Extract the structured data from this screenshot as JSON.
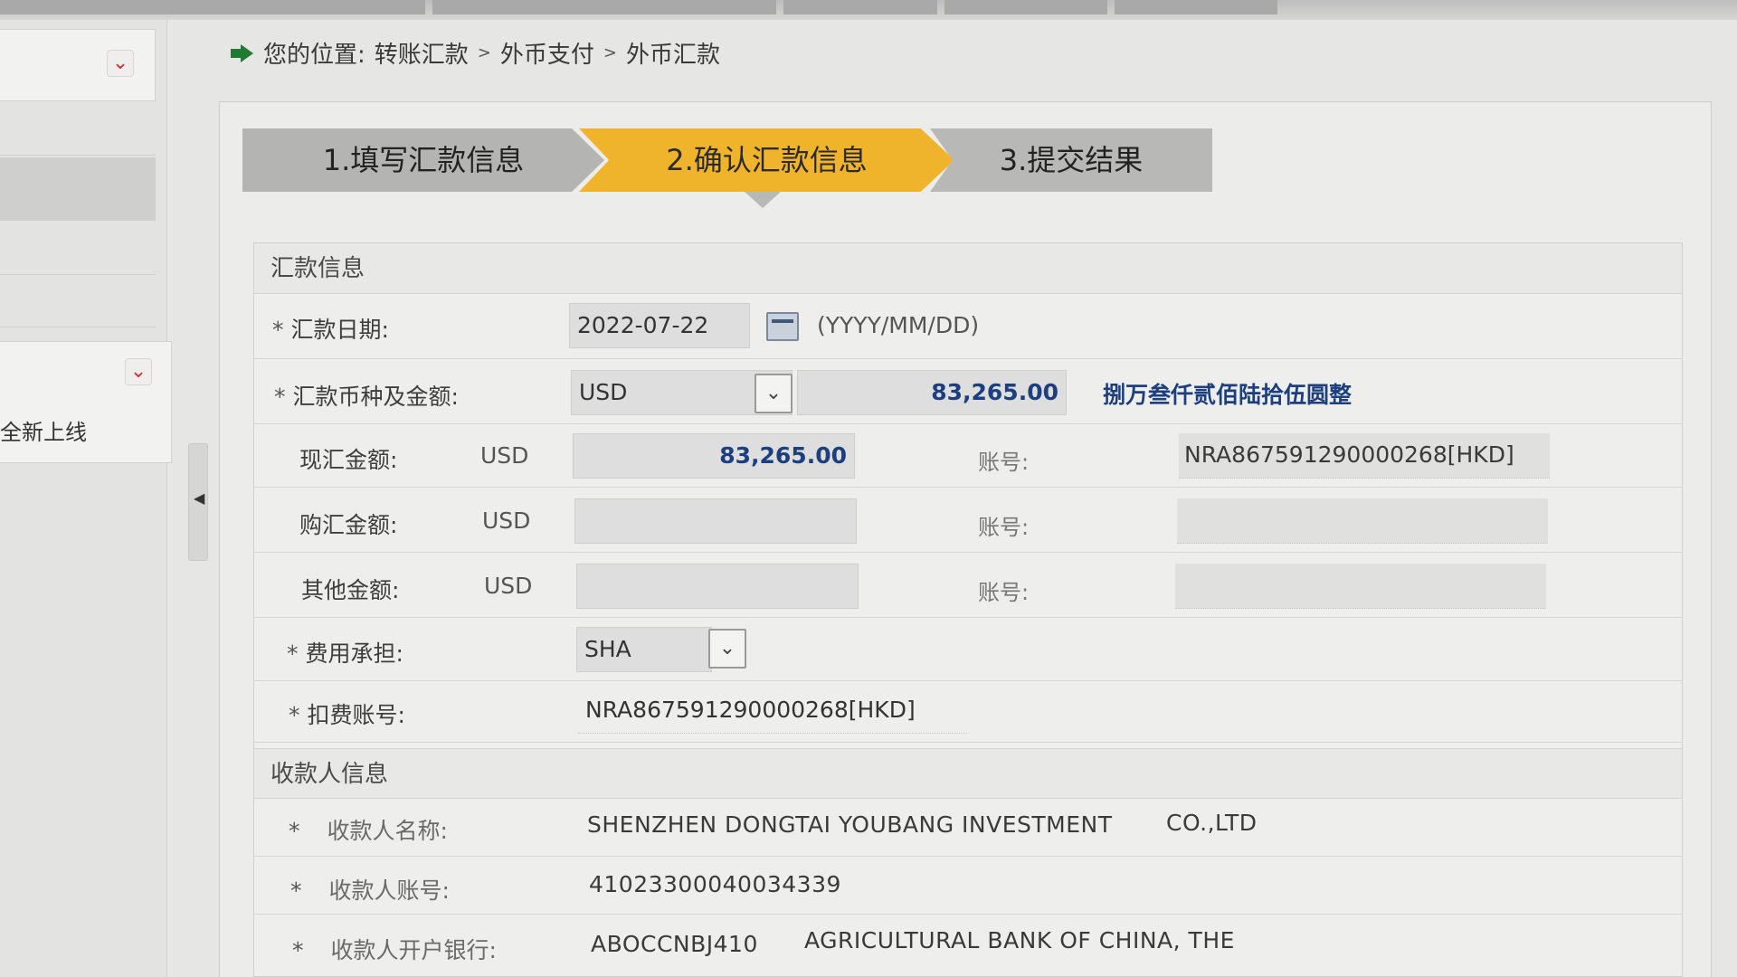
{
  "breadcrumb": {
    "prefix": "您的位置:",
    "items": [
      "转账汇款",
      "外币支付",
      "外币汇款"
    ],
    "sep": ">"
  },
  "sidebar": {
    "new_item_label": "全新上线"
  },
  "steps": [
    {
      "label": "1.填写汇款信息",
      "state": "done"
    },
    {
      "label": "2.确认汇款信息",
      "state": "active"
    },
    {
      "label": "3.提交结果",
      "state": "pending"
    }
  ],
  "remit": {
    "section_title": "汇款信息",
    "date_label": "汇款日期:",
    "date_value": "2022-07-22",
    "date_hint": "(YYYY/MM/DD)",
    "currency_label": "汇款币种及金额:",
    "currency_value": "USD",
    "amount": "83,265.00",
    "amount_words": "捌万叁仟贰佰陆拾伍圆整",
    "cash_label": "现汇金额:",
    "cash_currency": "USD",
    "cash_amount": "83,265.00",
    "cash_account_label": "账号:",
    "cash_account": "NRA867591290000268[HKD]",
    "purchase_label": "购汇金额:",
    "purchase_currency": "USD",
    "purchase_account_label": "账号:",
    "other_label": "其他金额:",
    "other_currency": "USD",
    "other_account_label": "账号:",
    "fee_label": "费用承担:",
    "fee_value": "SHA",
    "fee_account_label": "扣费账号:",
    "fee_account_value": "NRA867591290000268[HKD]",
    "required_mark": "*"
  },
  "payee": {
    "section_title": "收款人信息",
    "name_label": "收款人名称:",
    "name_value_1": "SHENZHEN DONGTAI YOUBANG INVESTMENT",
    "name_value_2": "CO.,LTD",
    "account_label": "收款人账号:",
    "account_value": "41023300040034339",
    "bank_label": "收款人开户银行:",
    "bank_swift": "ABOCCNBJ410",
    "bank_name": "AGRICULTURAL BANK OF CHINA, THE"
  },
  "icons": {
    "dropdown": "chevron-down-icon",
    "calendar": "calendar-icon",
    "collapse": "caret-left-icon"
  },
  "colors": {
    "active_step": "#f0b32c",
    "amount_text": "#1d3f7d",
    "breadcrumb_arrow": "#1f7a32"
  }
}
